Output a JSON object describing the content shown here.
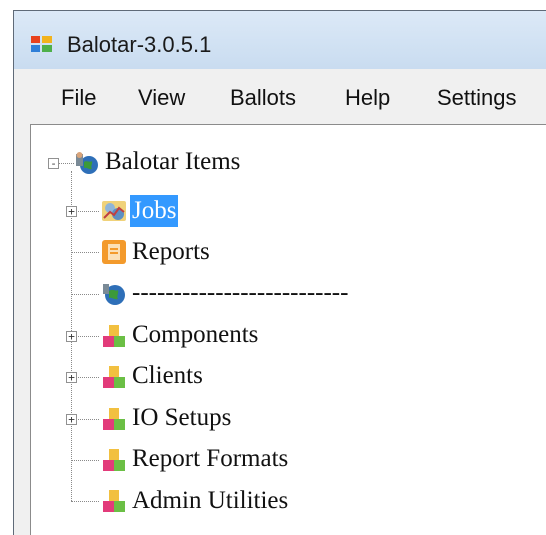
{
  "window": {
    "title": "Balotar-3.0.5.1"
  },
  "menu": [
    "File",
    "View",
    "Ballots",
    "Help",
    "Settings"
  ],
  "tree": {
    "root": {
      "label": "Balotar Items",
      "expander": "-"
    },
    "children": [
      {
        "label": "Jobs",
        "icon": "jobs-icon",
        "expander": "+",
        "selected": true
      },
      {
        "label": "Reports",
        "icon": "reports-icon",
        "expander": ""
      },
      {
        "label": "--------------------------",
        "icon": "globe-icon",
        "expander": ""
      },
      {
        "label": "Components",
        "icon": "blocks-icon",
        "expander": "+"
      },
      {
        "label": "Clients",
        "icon": "blocks-icon",
        "expander": "+"
      },
      {
        "label": "IO Setups",
        "icon": "blocks-icon",
        "expander": "+"
      },
      {
        "label": "Report Formats",
        "icon": "blocks-icon",
        "expander": ""
      },
      {
        "label": "Admin Utilities",
        "icon": "blocks-icon",
        "expander": ""
      }
    ]
  },
  "colors": {
    "selection": "#3399ff",
    "titlebar": "#dce9f7"
  }
}
